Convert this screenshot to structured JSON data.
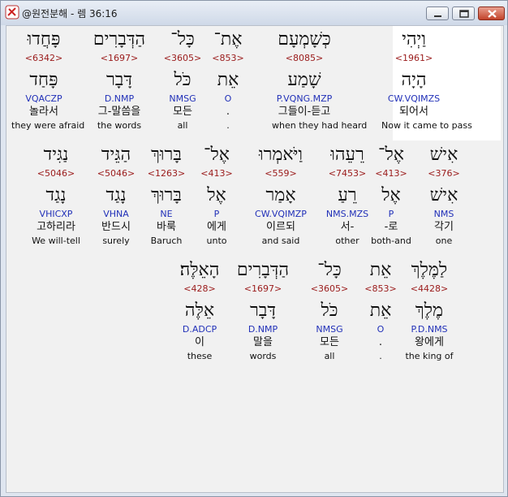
{
  "window": {
    "title": "@원전분해 - 렘 36:16",
    "controls": {
      "minimize": "minimize-icon",
      "maximize": "maximize-icon",
      "close": "close-icon"
    }
  },
  "colors": {
    "strong": "#9a1a1a",
    "parsing": "#2130b8",
    "highlight": "#ffffff"
  },
  "words": [
    {
      "heb": "וַיְהִי",
      "num": "<1961>",
      "lem": "הָיָה",
      "pars": "CW.VQIMZS",
      "ko": "되어서",
      "en": "Now it came to pass",
      "highlight": true
    },
    {
      "heb": "כְּשָׁמְעָם",
      "num": "<8085>",
      "lem": "שָׁמַע",
      "pars": "P.VQNG.MZP",
      "ko": "그들이-듣고",
      "en": "when they had heard"
    },
    {
      "heb": "אֶת־",
      "num": "<853>",
      "lem": "אֵת",
      "pars": "O",
      "ko": ".",
      "en": "."
    },
    {
      "heb": "כָּל־",
      "num": "<3605>",
      "lem": "כֹּל",
      "pars": "NMSG",
      "ko": "모든",
      "en": "all"
    },
    {
      "heb": "הַדְּבָרִים",
      "num": "<1697>",
      "lem": "דָּבָר",
      "pars": "D.NMP",
      "ko": "그-말씀을",
      "en": "the words"
    },
    {
      "heb": "פָּחֲדוּ",
      "num": "<6342>",
      "lem": "פָּחַד",
      "pars": "VQACZP",
      "ko": "놀라서",
      "en": "they were afraid"
    },
    {
      "heb": "אִישׁ",
      "num": "<376>",
      "lem": "אִישׁ",
      "pars": "NMS",
      "ko": "각기",
      "en": "one"
    },
    {
      "heb": "אֶל־",
      "num": "<413>",
      "lem": "אֶל",
      "pars": "P",
      "ko": "-로",
      "en": "both-and"
    },
    {
      "heb": "רֵעֵהוּ",
      "num": "<7453>",
      "lem": "רֵעַ",
      "pars": "NMS.MZS",
      "ko": "서-",
      "en": "other"
    },
    {
      "heb": "וַיֹּאמְרוּ",
      "num": "<559>",
      "lem": "אָמַר",
      "pars": "CW.VQIMZP",
      "ko": "이르되",
      "en": "and said"
    },
    {
      "heb": "אֶל־",
      "num": "<413>",
      "lem": "אֶל",
      "pars": "P",
      "ko": "에게",
      "en": "unto"
    },
    {
      "heb": "בָּרוּךְ",
      "num": "<1263>",
      "lem": "בָּרוּךְ",
      "pars": "NE",
      "ko": "바룩",
      "en": "Baruch"
    },
    {
      "heb": "הַגֵּיד",
      "num": "<5046>",
      "lem": "נָגַד",
      "pars": "VHNA",
      "ko": "반드시",
      "en": "surely"
    },
    {
      "heb": "נַגִּיד",
      "num": "<5046>",
      "lem": "נָגַד",
      "pars": "VHICXP",
      "ko": "고하리라",
      "en": "We will-tell"
    },
    {
      "heb": "לַמֶּלֶךְ",
      "num": "<4428>",
      "lem": "מֶלֶךְ",
      "pars": "P.D.NMS",
      "ko": "왕에게",
      "en": "the king of"
    },
    {
      "heb": "אֵת",
      "num": "<853>",
      "lem": "אֵת",
      "pars": "O",
      "ko": ".",
      "en": "."
    },
    {
      "heb": "כָּל־",
      "num": "<3605>",
      "lem": "כֹּל",
      "pars": "NMSG",
      "ko": "모든",
      "en": "all"
    },
    {
      "heb": "הַדְּבָרִים",
      "num": "<1697>",
      "lem": "דָּבָר",
      "pars": "D.NMP",
      "ko": "말을",
      "en": "words"
    },
    {
      "heb": "הָאֵלֶּה׃",
      "num": "<428>",
      "lem": "אֵלֶּה",
      "pars": "D.ADCP",
      "ko": "이",
      "en": "these"
    }
  ]
}
